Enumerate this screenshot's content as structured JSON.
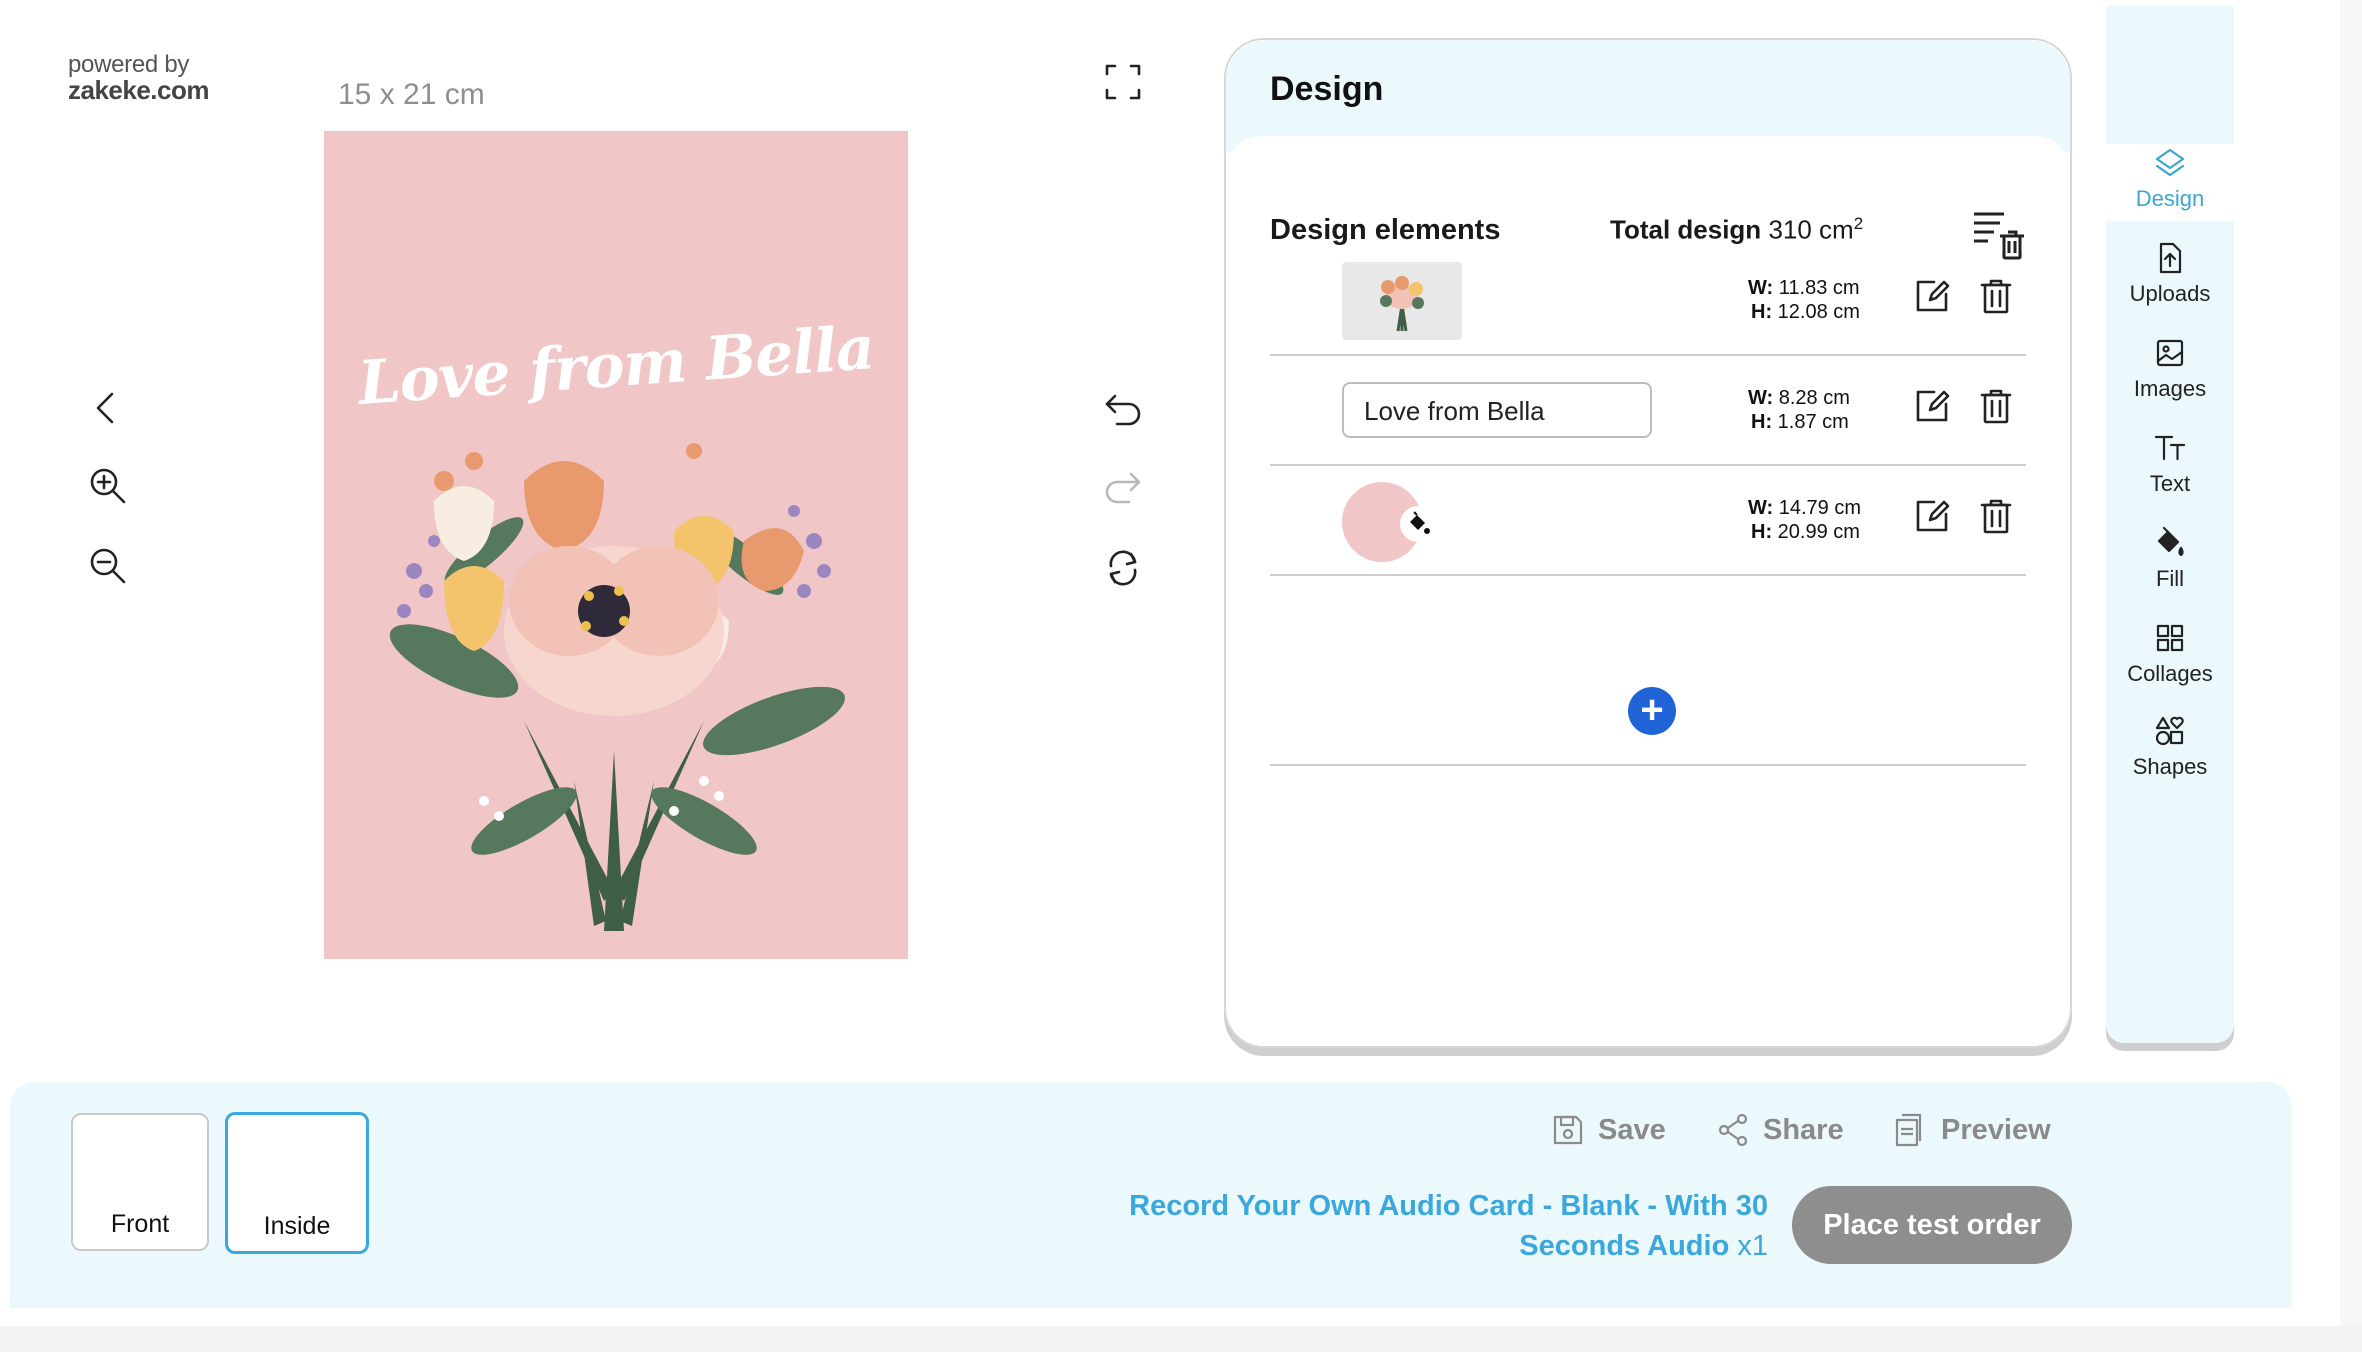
{
  "branding": {
    "powered_by": "powered by",
    "domain": "zakeke.com"
  },
  "canvas": {
    "size_label": "15 x 21 cm",
    "card_text": "Love from Bella",
    "card_color": "#f0c7c6"
  },
  "tools": {
    "left": [
      "chevron-left-icon",
      "zoom-in-icon",
      "zoom-out-icon"
    ],
    "right": [
      "fullscreen-icon",
      "undo-icon",
      "redo-icon",
      "rotate-icon"
    ]
  },
  "panel": {
    "title": "Design",
    "elements_title": "Design elements",
    "total_label": "Total design",
    "total_value": "310 cm",
    "total_unit_exp": "2",
    "rows": [
      {
        "type": "image",
        "w_label": "W:",
        "w": "11.83 cm",
        "h_label": "H:",
        "h": "12.08 cm"
      },
      {
        "type": "text",
        "text": "Love from Bella",
        "w_label": "W:",
        "w": "8.28 cm",
        "h_label": "H:",
        "h": "1.87 cm"
      },
      {
        "type": "fill",
        "w_label": "W:",
        "w": "14.79 cm",
        "h_label": "H:",
        "h": "20.99 cm"
      }
    ],
    "add_label": "+"
  },
  "rail": {
    "items": [
      {
        "label": "Design",
        "icon": "layers-icon",
        "active": true
      },
      {
        "label": "Uploads",
        "icon": "upload-icon"
      },
      {
        "label": "Images",
        "icon": "image-icon"
      },
      {
        "label": "Text",
        "icon": "text-icon"
      },
      {
        "label": "Fill",
        "icon": "fill-icon"
      },
      {
        "label": "Collages",
        "icon": "collage-icon"
      },
      {
        "label": "Shapes",
        "icon": "shapes-icon"
      }
    ]
  },
  "footer": {
    "sides": [
      {
        "label": "Front"
      },
      {
        "label": "Inside",
        "active": true
      }
    ],
    "save": "Save",
    "share": "Share",
    "preview": "Preview",
    "product_line1": "Record Your Own Audio Card - Blank - With 30",
    "product_line2": "Seconds Audio",
    "quantity": "x1",
    "order_button": "Place test order"
  },
  "colors": {
    "accent": "#3aa7dd",
    "add_button": "#1f63d6",
    "panel_bg": "#ebf9fd",
    "order_button": "#8e8e8e"
  }
}
